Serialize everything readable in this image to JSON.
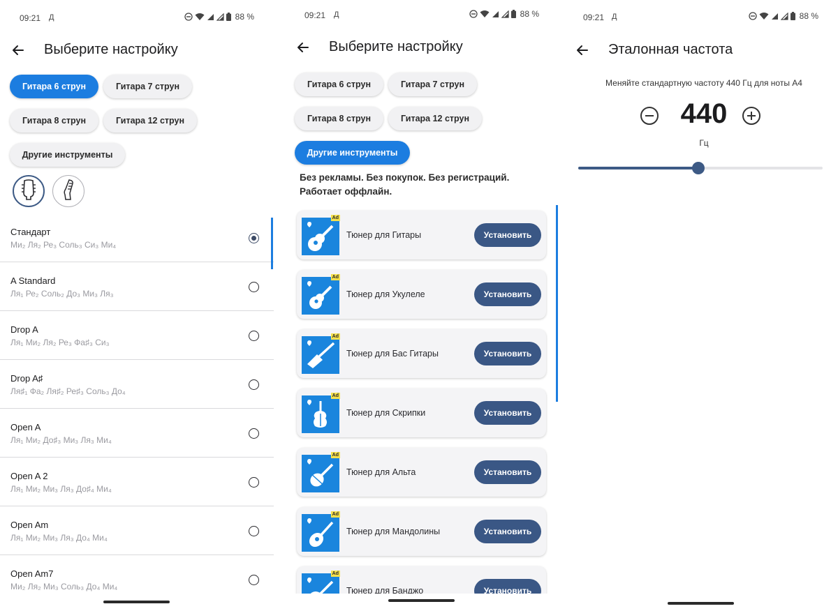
{
  "status_bar": {
    "time": "09:21",
    "indicator": "Д",
    "battery": "88 %"
  },
  "screen1": {
    "title": "Выберите настройку",
    "chips": [
      "Гитара 6 струн",
      "Гитара 7 струн",
      "Гитара 8 струн",
      "Гитара 12 струн",
      "Другие инструменты"
    ],
    "active_chip": "Гитара 6 струн",
    "tunings": [
      {
        "name": "Стандарт",
        "notes": "Ми₂ Ля₂ Ре₃ Соль₃ Си₃ Ми₄",
        "selected": true
      },
      {
        "name": "A Standard",
        "notes": "Ля₁ Ре₂ Соль₂ До₃ Ми₃ Ля₃",
        "selected": false
      },
      {
        "name": "Drop A",
        "notes": "Ля₁ Ми₂ Ля₂ Ре₃ Фа♯₃ Си₃",
        "selected": false
      },
      {
        "name": "Drop A♯",
        "notes": "Ля♯₁ Фа₂ Ля♯₂ Ре♯₃ Соль₃ До₄",
        "selected": false
      },
      {
        "name": "Open A",
        "notes": "Ля₁ Ми₂ До♯₃ Ми₃ Ля₃ Ми₄",
        "selected": false
      },
      {
        "name": "Open A 2",
        "notes": "Ля₁ Ми₂ Ми₃ Ля₃ До♯₄ Ми₄",
        "selected": false
      },
      {
        "name": "Open Am",
        "notes": "Ля₁ Ми₂ Ми₃ Ля₃ До₄ Ми₄",
        "selected": false
      },
      {
        "name": "Open Am7",
        "notes": "Ми₂ Ля₂ Ми₃ Соль₃ До₄ Ми₄",
        "selected": false
      }
    ]
  },
  "screen2": {
    "title": "Выберите настройку",
    "chips": [
      "Гитара 6 струн",
      "Гитара 7 струн",
      "Гитара 8 струн",
      "Гитара 12 струн",
      "Другие инструменты"
    ],
    "active_chip": "Другие инструменты",
    "promo_line1": "Без рекламы. Без покупок. Без регистраций.",
    "promo_line2": "Работает оффлайн.",
    "ad_badge": "Ad",
    "install_label": "Установить",
    "apps": [
      {
        "name": "Тюнер для Гитары",
        "icon": "acoustic-guitar-icon"
      },
      {
        "name": "Тюнер для Укулеле",
        "icon": "ukulele-icon"
      },
      {
        "name": "Тюнер для Бас Гитары",
        "icon": "bass-guitar-icon"
      },
      {
        "name": "Тюнер для Скрипки",
        "icon": "violin-icon"
      },
      {
        "name": "Тюнер для Альта",
        "icon": "viola-icon"
      },
      {
        "name": "Тюнер для Мандолины",
        "icon": "mandolin-icon"
      },
      {
        "name": "Тюнер для Банджо",
        "icon": "banjo-icon"
      }
    ]
  },
  "screen3": {
    "title": "Эталонная частота",
    "description": "Меняйте стандартную частоту 440 Гц для ноты A4",
    "value": "440",
    "unit": "Гц",
    "slider_fraction": 0.49
  },
  "colors": {
    "accent": "#1c7de0",
    "install": "#3a5785",
    "slider": "#3d5a85"
  }
}
